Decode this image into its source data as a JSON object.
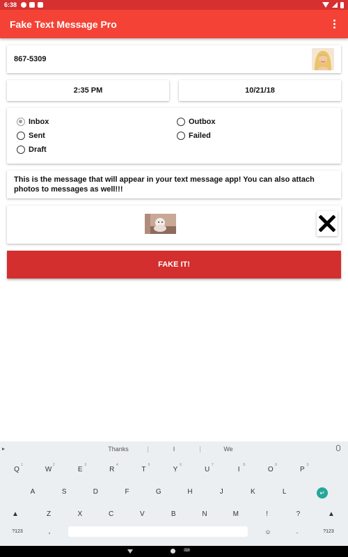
{
  "status_bar": {
    "time": "6:38"
  },
  "app_bar": {
    "title": "Fake Text Message Pro"
  },
  "phone_number": "867-5309",
  "time": "2:35 PM",
  "date": "10/21/18",
  "radio_options": {
    "inbox": "Inbox",
    "outbox": "Outbox",
    "sent": "Sent",
    "failed": "Failed",
    "draft": "Draft",
    "selected": "Inbox"
  },
  "message": "This is the message that will appear in your text message app!  You can also attach photos to messages as well!!!",
  "fake_button": "FAKE IT!",
  "keyboard": {
    "suggestions": [
      "Thanks",
      "I",
      "We"
    ],
    "row1": [
      "Q",
      "W",
      "E",
      "R",
      "T",
      "Y",
      "U",
      "I",
      "O",
      "P"
    ],
    "row1_hints": [
      "1",
      "2",
      "3",
      "4",
      "5",
      "6",
      "7",
      "8",
      "9",
      "0"
    ],
    "row2": [
      "A",
      "S",
      "D",
      "F",
      "G",
      "H",
      "J",
      "K",
      "L"
    ],
    "row3": [
      "Z",
      "X",
      "C",
      "V",
      "B",
      "N",
      "M",
      "!",
      "?"
    ],
    "symbols_label": "?123",
    "comma": ",",
    "period": ".",
    "emoji_icon": "emoji-icon",
    "enter_icon": "enter-icon"
  },
  "colors": {
    "primary": "#f44336",
    "status": "#d63031",
    "button": "#d32f2f",
    "enter": "#26a69a"
  }
}
